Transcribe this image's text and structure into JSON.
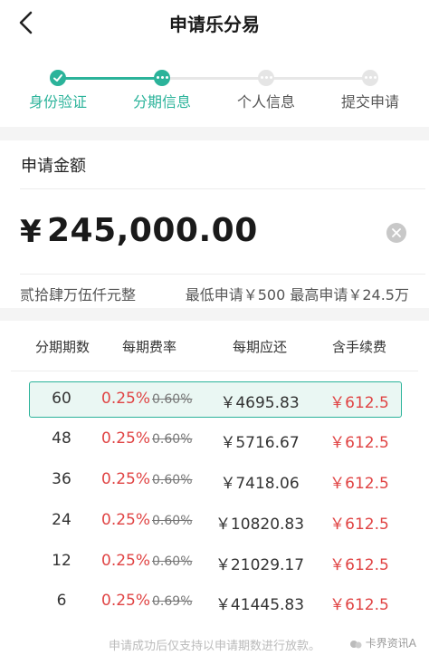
{
  "header": {
    "title": "申请乐分易",
    "back_icon": "chevron-left-icon"
  },
  "steps": [
    {
      "label": "身份验证",
      "status": "done"
    },
    {
      "label": "分期信息",
      "status": "current"
    },
    {
      "label": "个人信息",
      "status": "todo"
    },
    {
      "label": "提交申请",
      "status": "todo"
    }
  ],
  "amount": {
    "title": "申请金额",
    "currency": "¥",
    "value": "245,000.00",
    "words": "贰拾肆万伍仟元整",
    "limits": "最低申请￥500 最高申请￥24.5万"
  },
  "table": {
    "headers": [
      "分期期数",
      "每期费率",
      "每期应还",
      "含手续费"
    ],
    "rows": [
      {
        "term": "60",
        "rate": "0.25%",
        "old_rate": "0.60%",
        "payment": "￥4695.83",
        "fee": "￥612.5",
        "selected": true
      },
      {
        "term": "48",
        "rate": "0.25%",
        "old_rate": "0.60%",
        "payment": "￥5716.67",
        "fee": "￥612.5",
        "selected": false
      },
      {
        "term": "36",
        "rate": "0.25%",
        "old_rate": "0.60%",
        "payment": "￥7418.06",
        "fee": "￥612.5",
        "selected": false
      },
      {
        "term": "24",
        "rate": "0.25%",
        "old_rate": "0.60%",
        "payment": "￥10820.83",
        "fee": "￥612.5",
        "selected": false
      },
      {
        "term": "12",
        "rate": "0.25%",
        "old_rate": "0.60%",
        "payment": "￥21029.17",
        "fee": "￥612.5",
        "selected": false
      },
      {
        "term": "6",
        "rate": "0.25%",
        "old_rate": "0.69%",
        "payment": "￥41445.83",
        "fee": "￥612.5",
        "selected": false
      }
    ]
  },
  "footnote": "申请成功后仅支持以申请期数进行放款。",
  "watermark": "卡界资讯A",
  "colors": {
    "accent": "#2bb39a",
    "rate_red": "#e04444"
  }
}
